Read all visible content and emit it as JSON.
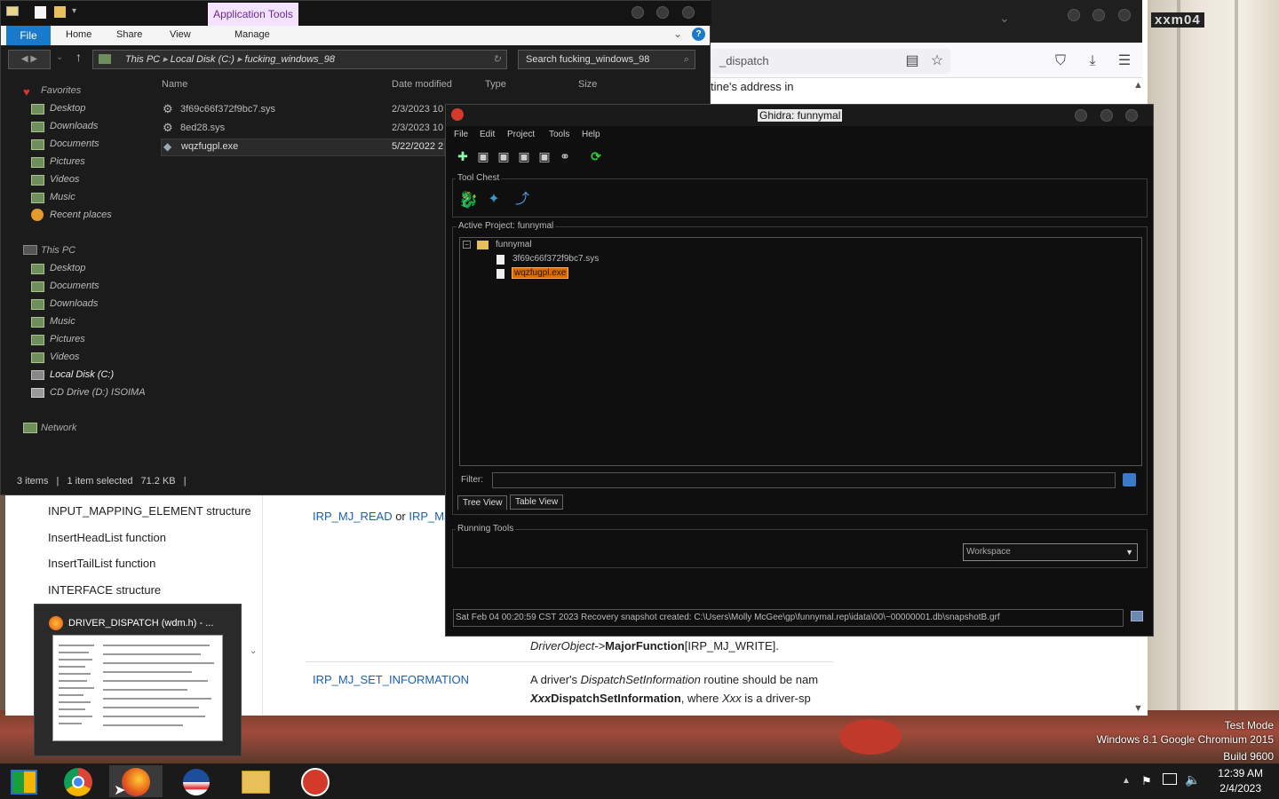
{
  "explorer": {
    "context_tab": "Application Tools",
    "ribbon_file": "File",
    "ribbon_tabs": [
      "Home",
      "Share",
      "View",
      "Manage"
    ],
    "breadcrumb": [
      "This PC",
      "Local Disk (C:)",
      "fucking_windows_98"
    ],
    "search_placeholder": "Search fucking_windows_98",
    "columns": [
      "Name",
      "Date modified",
      "Type",
      "Size"
    ],
    "files": [
      {
        "name": "3f69c66f372f9bc7.sys",
        "date": "2/3/2023 10"
      },
      {
        "name": "8ed28.sys",
        "date": "2/3/2023 10"
      },
      {
        "name": "wqzfugpl.exe",
        "date": "5/22/2022 2"
      }
    ],
    "favorites_label": "Favorites",
    "favorites": [
      "Desktop",
      "Downloads",
      "Documents",
      "Pictures",
      "Videos",
      "Music",
      "Recent places"
    ],
    "thispc_label": "This PC",
    "thispc": [
      "Desktop",
      "Documents",
      "Downloads",
      "Music",
      "Pictures",
      "Videos",
      "Local Disk (C:)",
      "CD Drive (D:) ISOIMA"
    ],
    "network_label": "Network",
    "status": {
      "items": "3 items",
      "selected": "1 item selected",
      "size": "71.2 KB"
    }
  },
  "browser": {
    "url_fragment": "_dispatch",
    "top_text": "tine's address in",
    "sidebar_items": [
      "INPUT_MAPPING_ELEMENT structure",
      "InsertHeadList function",
      "InsertTailList function",
      "INTERFACE structure"
    ],
    "link1": "IRP_MJ_READ",
    "or_text": "or",
    "link2": "IRP_MJ_",
    "code_line": "DriverObject->",
    "code_bold": "MajorFunction",
    "code_tail": "[IRP_MJ_WRITE].",
    "link3": "IRP_MJ_SET_INFORMATION",
    "para1_a": "A driver's ",
    "para1_b": "DispatchSetInformation",
    "para1_c": " routine should be nam",
    "para2_a": "Xxx",
    "para2_b": "DispatchSetInformation",
    "para2_c": ", where ",
    "para2_d": "Xxx",
    "para2_e": " is a driver-sp"
  },
  "ghidra": {
    "title": "Ghidra: funnymal",
    "menu": [
      "File",
      "Edit",
      "Project",
      "Tools",
      "Help"
    ],
    "tool_chest_label": "Tool Chest",
    "active_project_label": "Active Project: funnymal",
    "tree_root": "funnymal",
    "tree_items": [
      "3f69c66f372f9bc7.sys",
      "wqzfugpl.exe"
    ],
    "filter_label": "Filter:",
    "tabs": [
      "Tree View",
      "Table View"
    ],
    "running_tools_label": "Running Tools",
    "workspace": "Workspace",
    "status": "Sat Feb 04 00:20:59 CST 2023 Recovery snapshot created: C:\\Users\\Molly McGee\\gp\\funnymal.rep\\idata\\00\\~00000001.db\\snapshotB.grf"
  },
  "thumbnail": {
    "title": "DRIVER_DISPATCH (wdm.h) - ..."
  },
  "watermark": {
    "line1": "Test Mode",
    "line2": "Windows 8.1 Google Chromium 2015",
    "line3": "Build 9600"
  },
  "clock": {
    "time": "12:39 AM",
    "date": "2/4/2023"
  },
  "desktop_label": "xxm04",
  "colors": {
    "file_tab": "#1979ca",
    "selection": "#e06a00",
    "app_tools": "#f3e3ff"
  }
}
